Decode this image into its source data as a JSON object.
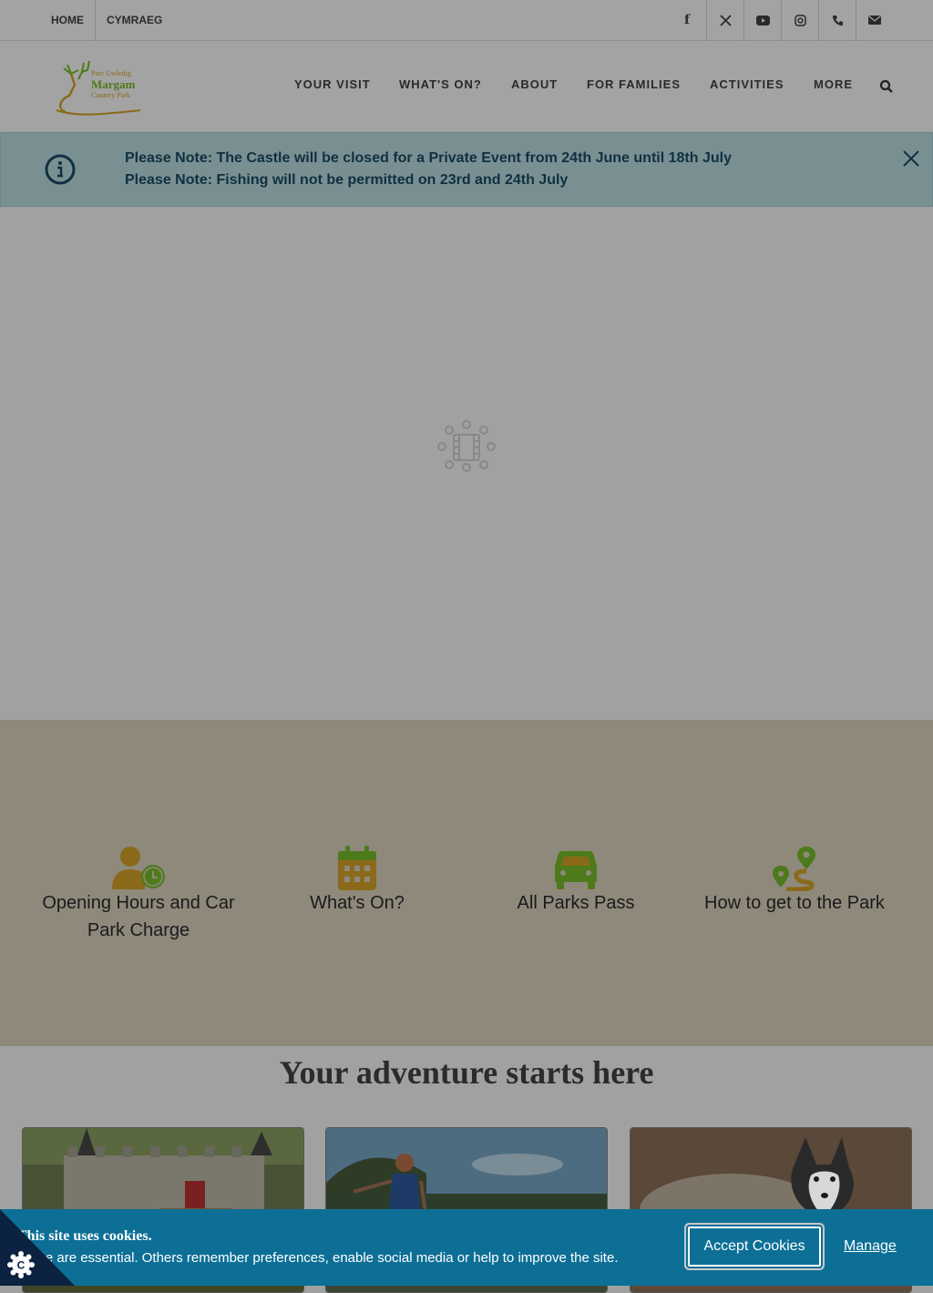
{
  "topbar": {
    "links": [
      {
        "label": "HOME"
      },
      {
        "label": "CYMRAEG"
      }
    ],
    "social": [
      {
        "icon": "facebook-icon",
        "glyph": "f"
      },
      {
        "icon": "x-twitter-icon",
        "glyph": "𝕏"
      },
      {
        "icon": "youtube-icon",
        "glyph": ""
      },
      {
        "icon": "instagram-icon",
        "glyph": ""
      },
      {
        "icon": "phone-icon",
        "glyph": ""
      },
      {
        "icon": "email-icon",
        "glyph": ""
      }
    ]
  },
  "header": {
    "logo": {
      "line1": "Parc Gwledig",
      "line2": "Margam",
      "line3": "Country Park"
    },
    "nav": [
      {
        "label": "YOUR VISIT"
      },
      {
        "label": "WHAT'S ON?"
      },
      {
        "label": "ABOUT"
      },
      {
        "label": "FOR FAMILIES"
      },
      {
        "label": "ACTIVITIES"
      },
      {
        "label": "MORE"
      }
    ],
    "search_icon": "search-icon"
  },
  "notice": {
    "icon": "info-icon",
    "lines": [
      "Please Note: The Castle will be closed for a Private Event from 24th June until 18th July",
      "Please Note: Fishing will not be permitted on 23rd and 24th July"
    ],
    "close_icon": "close-icon"
  },
  "hero": {
    "loader_icon": "film-reel-loading-icon"
  },
  "quick_links": [
    {
      "icon": "user-clock-icon",
      "label": "Opening Hours and Car Park Charge",
      "color": "#8a6a1a"
    },
    {
      "icon": "calendar-icon",
      "label": "What's On?",
      "color": "#8a6a1a"
    },
    {
      "icon": "car-icon",
      "label": "All Parks Pass",
      "color": "#4d7a1a"
    },
    {
      "icon": "route-icon",
      "label": "How to get to the Park",
      "color": "#4d7a1a"
    }
  ],
  "section": {
    "heading": "Your adventure starts here"
  },
  "cookie": {
    "title": "This site uses cookies.",
    "text": "Some are essential. Others remember preferences, enable social media or help to improve the site.",
    "accept_label": "Accept Cookies",
    "manage_label": "Manage",
    "badge_icon": "cookie-control-icon"
  },
  "colors": {
    "notice_bg": "#7a8f92",
    "notice_text": "#0f3040",
    "quick_bg": "#8f897c",
    "cookie_bg": "#0d6f96",
    "brand_gold": "#8a6a1a",
    "brand_green": "#4d7a1a"
  }
}
